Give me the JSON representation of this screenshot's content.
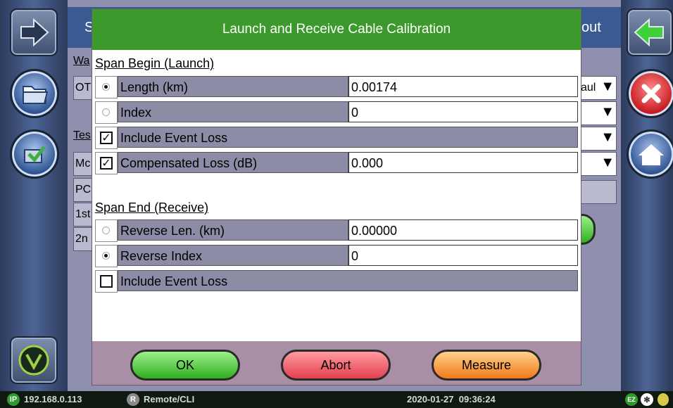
{
  "dialog": {
    "title": "Launch and Receive Cable Calibration",
    "span_begin": {
      "heading": "Span Begin (Launch)",
      "rows": [
        {
          "label": "Length (km)",
          "value": "0.00174"
        },
        {
          "label": "Index",
          "value": "0"
        },
        {
          "label": "Include Event Loss"
        },
        {
          "label": "Compensated Loss (dB)",
          "value": "0.000"
        }
      ]
    },
    "span_end": {
      "heading": "Span End (Receive)",
      "rows": [
        {
          "label": "Reverse Len. (km)",
          "value": "0.00000"
        },
        {
          "label": "Reverse Index",
          "value": "0"
        },
        {
          "label": "Include Event Loss"
        }
      ]
    },
    "buttons": {
      "ok": "OK",
      "abort": "Abort",
      "measure": "Measure"
    }
  },
  "background": {
    "title_fragment_left": "S",
    "title_fragment_right": "out",
    "label_wa": "Wa",
    "cell_ot": "OT",
    "label_tes": "Tes",
    "cell_mc": "Mc",
    "cell_pc": "PC",
    "cell_1st": "1st",
    "cell_2n": "2n",
    "dropdown_fragment": "aul",
    "dropdown_arrow": "▼"
  },
  "statusbar": {
    "ip_badge": "IP",
    "ip_address": "192.168.0.113",
    "remote_badge": "R",
    "remote_label": "Remote/CLI",
    "datetime": "2020-01-27  09:36:24",
    "ez_badge": "EZ",
    "bt_badge": "✻"
  },
  "colors": {
    "title_green": "#3c9a2c",
    "ok_green": "#2fae1f",
    "abort_red": "#e2404e",
    "measure_orange": "#f07a1a"
  }
}
